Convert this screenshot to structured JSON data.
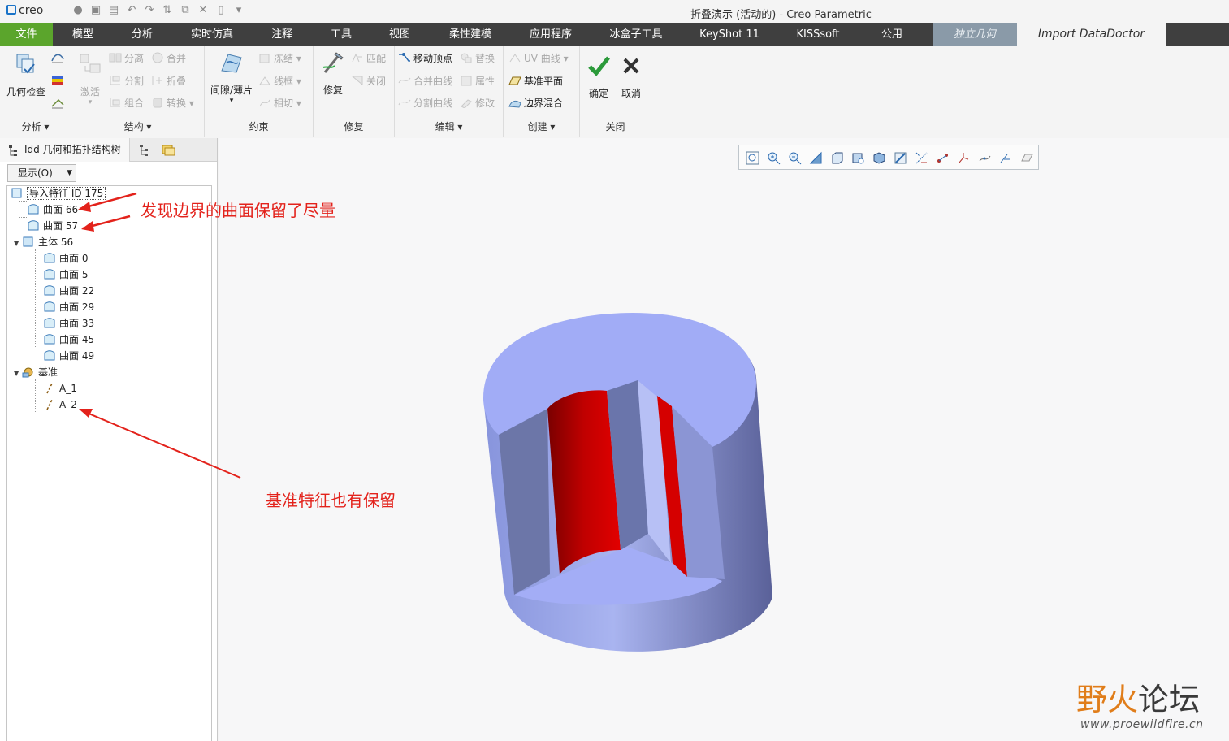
{
  "window": {
    "logo_text": "creo",
    "title": "折叠演示 (活动的) - Creo Parametric"
  },
  "menu_tabs": [
    "文件",
    "模型",
    "分析",
    "实时仿真",
    "注释",
    "工具",
    "视图",
    "柔性建模",
    "应用程序",
    "冰盒子工具",
    "KeyShot 11",
    "KISSsoft",
    "公用",
    "独立几何",
    "Import DataDoctor"
  ],
  "ribbon": {
    "analysis": {
      "big": "几何检查",
      "label": "分析"
    },
    "structure": {
      "activate": "激活",
      "separate": "分离",
      "split": "分割",
      "combine": "组合",
      "merge": "合并",
      "fold": "折叠",
      "convert": "转换",
      "label": "结构"
    },
    "constraint": {
      "big": "间隙/薄片",
      "freeze": "冻结",
      "wireframe": "线框",
      "tangent": "相切",
      "label": "约束"
    },
    "repair": {
      "big": "修复",
      "match": "匹配",
      "close": "关闭",
      "label": "修复"
    },
    "edit": {
      "move_vertex": "移动顶点",
      "replace": "替换",
      "merge_curve": "合并曲线",
      "attribute": "属性",
      "split_curve": "分割曲线",
      "modify": "修改",
      "label": "编辑"
    },
    "create": {
      "uv_curve": "UV 曲线",
      "datum_plane": "基准平面",
      "boundary_blend": "边界混合",
      "label": "创建"
    },
    "close": {
      "ok": "确定",
      "cancel": "取消",
      "label": "关闭"
    }
  },
  "panel": {
    "tab_label": "Idd 几何和拓扑结构树",
    "show_button": "显示(O)",
    "tree": {
      "root": "导入特征 ID 175",
      "surface_66": "曲面 66",
      "surface_57": "曲面 57",
      "body": "主体 56",
      "body_surfaces": [
        "曲面 0",
        "曲面 5",
        "曲面 22",
        "曲面 29",
        "曲面 33",
        "曲面 45",
        "曲面 49"
      ],
      "datum": "基准",
      "axes": [
        "A_1",
        "A_2"
      ]
    }
  },
  "annotations": {
    "boundary_note": "发现边界的曲面保留了尽量",
    "datum_note": "基准特征也有保留"
  },
  "watermark": {
    "brand_a": "野",
    "brand_b": "火",
    "brand_c": "论坛",
    "url": "www.proewildfire.cn"
  },
  "colors": {
    "file_tab": "#5ba52c",
    "menu_bar": "#3f3f3f",
    "model_body": "#9aa6ee",
    "highlight_red": "#c80000",
    "annotation": "#e3221b"
  }
}
